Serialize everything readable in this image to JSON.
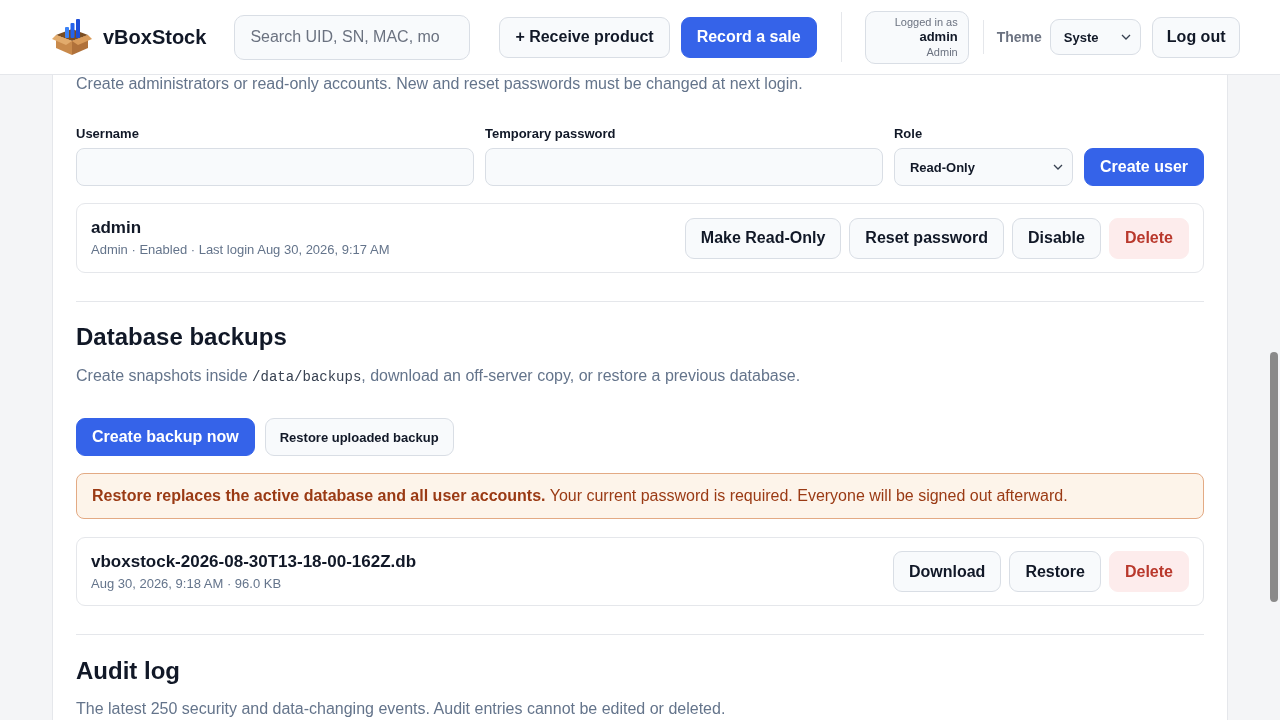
{
  "header": {
    "app_name": "vBoxStock",
    "search": {
      "placeholder": "Search UID, SN, MAC, mo"
    },
    "actions": [
      {
        "label": "+ Receive product",
        "kind": "secondary"
      },
      {
        "label": "Record a sale",
        "kind": "primary"
      }
    ],
    "account": {
      "caption": "Logged in as",
      "name": "admin",
      "role": "Admin"
    },
    "theme": {
      "label": "Theme",
      "value": "Syste"
    },
    "logout": {
      "label": "Log out",
      "kind": "secondary"
    }
  },
  "users_section": {
    "description": "Create administrators or read-only accounts. New and reset passwords must be changed at next login.",
    "form": {
      "fields": [
        {
          "label": "Username",
          "kind": "text"
        },
        {
          "label": "Temporary password",
          "kind": "text"
        },
        {
          "label": "Role",
          "kind": "select",
          "value": "Read-Only"
        }
      ],
      "submit": {
        "label": "Create user",
        "kind": "primary"
      }
    },
    "users": [
      {
        "name": "admin",
        "meta": "Admin · Enabled · Last login Aug 30, 2026, 9:17 AM",
        "actions": [
          {
            "label": "Make Read-Only",
            "kind": "secondary"
          },
          {
            "label": "Reset password",
            "kind": "secondary"
          },
          {
            "label": "Disable",
            "kind": "secondary"
          },
          {
            "label": "Delete",
            "kind": "danger"
          }
        ]
      }
    ]
  },
  "backups_section": {
    "title": "Database backups",
    "description": {
      "before": "Create snapshots inside ",
      "code": "/data/backups",
      "after": ", download an off-server copy, or restore a previous database."
    },
    "actions": [
      {
        "label": "Create backup now",
        "kind": "primary"
      },
      {
        "label": "Restore uploaded backup",
        "kind": "compact"
      }
    ],
    "warning": "**Restore replaces the active database and all user accounts.** Your current password is required. Everyone will be signed out afterward.",
    "files": [
      {
        "name": "vboxstock-2026-08-30T13-18-00-162Z.db",
        "meta": "Aug 30, 2026, 9:18 AM · 96.0 KB",
        "actions": [
          {
            "label": "Download",
            "kind": "secondary"
          },
          {
            "label": "Restore",
            "kind": "secondary"
          },
          {
            "label": "Delete",
            "kind": "danger"
          }
        ]
      }
    ]
  },
  "audit_section": {
    "title": "Audit log",
    "description": "The latest 250 security and data-changing events. Audit entries cannot be edited or deleted."
  }
}
